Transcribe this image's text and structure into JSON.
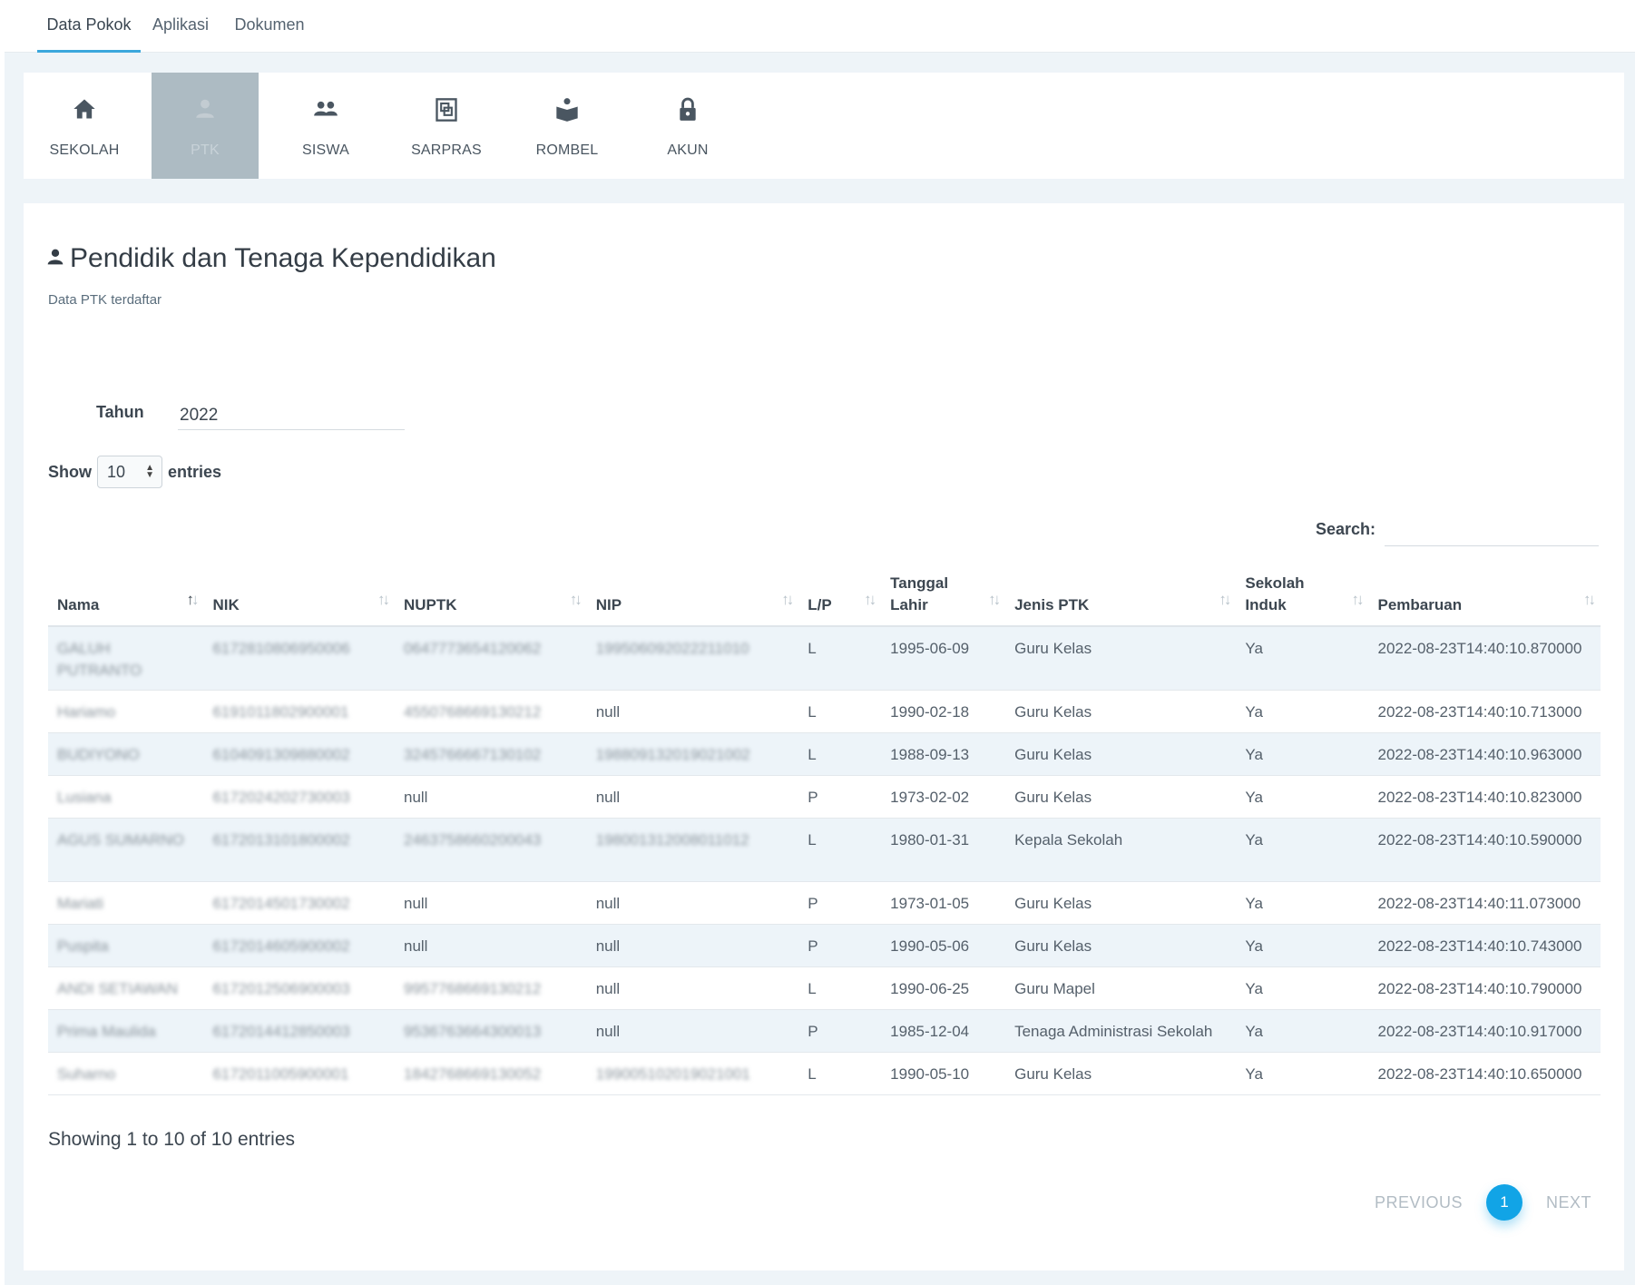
{
  "top_tabs": [
    {
      "label": "Data Pokok",
      "active": true
    },
    {
      "label": "Aplikasi",
      "active": false
    },
    {
      "label": "Dokumen",
      "active": false
    }
  ],
  "menu": [
    {
      "label": "SEKOLAH",
      "icon": "home-icon"
    },
    {
      "label": "PTK",
      "icon": "person-icon",
      "active": true
    },
    {
      "label": "SISWA",
      "icon": "users-icon"
    },
    {
      "label": "SARPRAS",
      "icon": "building-icon"
    },
    {
      "label": "ROMBEL",
      "icon": "reader-icon"
    },
    {
      "label": "AKUN",
      "icon": "lock-icon"
    }
  ],
  "page": {
    "title": "Pendidik dan Tenaga Kependidikan",
    "subtitle": "Data PTK terdaftar"
  },
  "filter": {
    "tahun_label": "Tahun",
    "tahun_value": "2022",
    "show_label": "Show",
    "show_value": "10",
    "entries_label": "entries",
    "search_label": "Search:",
    "search_value": ""
  },
  "table": {
    "columns": [
      "Nama",
      "NIK",
      "NUPTK",
      "NIP",
      "L/P",
      "Tanggal Lahir",
      "Jenis PTK",
      "Sekolah Induk",
      "Pembaruan"
    ],
    "rows": [
      [
        "GALUH PUTRANTO",
        "6172810806950006",
        "0647773654120062",
        "199506092022211010",
        "L",
        "1995-06-09",
        "Guru Kelas",
        "Ya",
        "2022-08-23T14:40:10.870000"
      ],
      [
        "Hariamo",
        "6191011802900001",
        "4550768669130212",
        "null",
        "L",
        "1990-02-18",
        "Guru Kelas",
        "Ya",
        "2022-08-23T14:40:10.713000"
      ],
      [
        "BUDIYONO",
        "6104091309880002",
        "3245766667130102",
        "198809132019021002",
        "L",
        "1988-09-13",
        "Guru Kelas",
        "Ya",
        "2022-08-23T14:40:10.963000"
      ],
      [
        "Lusiana",
        "6172024202730003",
        "null",
        "null",
        "P",
        "1973-02-02",
        "Guru Kelas",
        "Ya",
        "2022-08-23T14:40:10.823000"
      ],
      [
        "AGUS SUMARNO",
        "6172013101800002",
        "2463758660200043",
        "198001312008011012",
        "L",
        "1980-01-31",
        "Kepala Sekolah",
        "Ya",
        "2022-08-23T14:40:10.590000"
      ],
      [
        "Mariati",
        "6172014501730002",
        "null",
        "null",
        "P",
        "1973-01-05",
        "Guru Kelas",
        "Ya",
        "2022-08-23T14:40:11.073000"
      ],
      [
        "Puspita",
        "6172014605900002",
        "null",
        "null",
        "P",
        "1990-05-06",
        "Guru Kelas",
        "Ya",
        "2022-08-23T14:40:10.743000"
      ],
      [
        "ANDI SETIAWAN",
        "6172012506900003",
        "9957768669130212",
        "null",
        "L",
        "1990-06-25",
        "Guru Mapel",
        "Ya",
        "2022-08-23T14:40:10.790000"
      ],
      [
        "Prima Maulida",
        "6172014412850003",
        "9536763664300013",
        "null",
        "P",
        "1985-12-04",
        "Tenaga Administrasi Sekolah",
        "Ya",
        "2022-08-23T14:40:10.917000"
      ],
      [
        "Suharno",
        "6172011005900001",
        "1842768669130052",
        "199005102019021001",
        "L",
        "1990-05-10",
        "Guru Kelas",
        "Ya",
        "2022-08-23T14:40:10.650000"
      ]
    ]
  },
  "footer": {
    "info": "Showing 1 to 10 of 10 entries",
    "previous": "PREVIOUS",
    "page": "1",
    "next": "NEXT"
  },
  "colors": {
    "accent": "#11a4e6",
    "active_menu": "#adbbc3",
    "stripe": "#edf4f9"
  }
}
